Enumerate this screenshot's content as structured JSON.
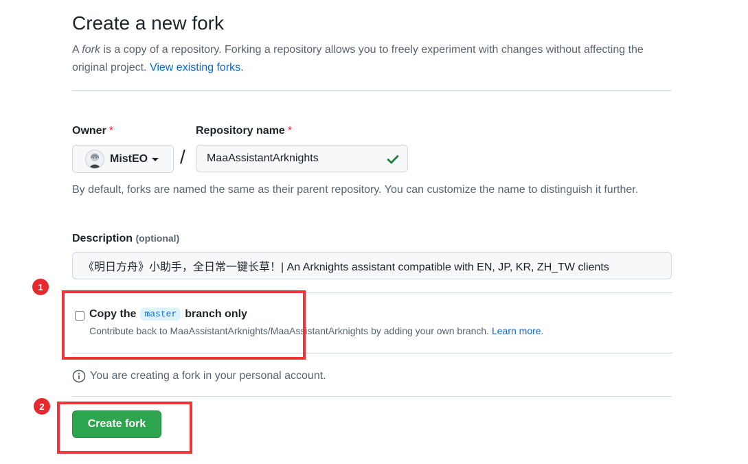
{
  "header": {
    "title": "Create a new fork",
    "intro_prefix": "A ",
    "intro_em": "fork",
    "intro_rest": " is a copy of a repository. Forking a repository allows you to freely experiment with changes without affecting the original project.",
    "view_forks_link": "View existing forks."
  },
  "owner": {
    "label": "Owner",
    "required_mark": "*",
    "selected": "MistEO"
  },
  "separator": "/",
  "repo": {
    "label": "Repository name",
    "required_mark": "*",
    "value": "MaaAssistantArknights"
  },
  "name_hint": "By default, forks are named the same as their parent repository. You can customize the name to distinguish it further.",
  "description": {
    "label": "Description",
    "optional": "(optional)",
    "value": "《明日方舟》小助手，全日常一键长草！| An Arknights assistant compatible with EN, JP, KR, ZH_TW clients"
  },
  "copy_branch": {
    "checked": false,
    "label_prefix": "Copy the",
    "branch": "master",
    "label_suffix": "branch only",
    "sub": "Contribute back to MaaAssistantArknights/MaaAssistantArknights by adding your own branch.",
    "learn_more": "Learn more."
  },
  "account_notice": "You are creating a fork in your personal account.",
  "create_button": "Create fork",
  "annotations": {
    "badge1": "1",
    "badge2": "2",
    "highlight_color": "#f0353a"
  },
  "colors": {
    "primary_green": "#2da44e",
    "link_blue": "#0969da",
    "required_red": "#d1242f"
  }
}
